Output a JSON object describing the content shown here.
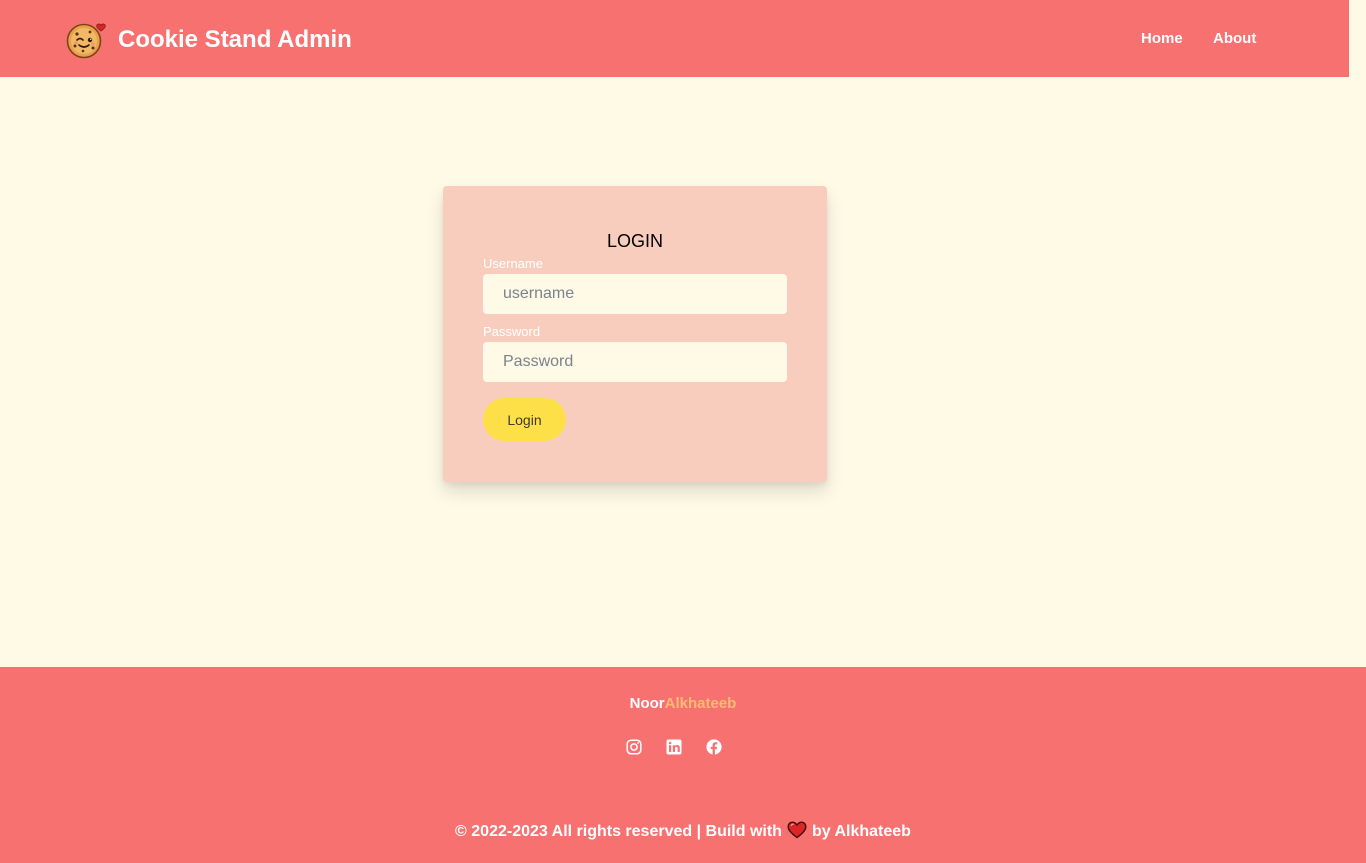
{
  "header": {
    "title": "Cookie Stand Admin",
    "logo_icon": "cookie-mascot-icon",
    "nav": {
      "home": "Home",
      "about": "About"
    }
  },
  "login": {
    "title": "LOGIN",
    "username": {
      "label": "Username",
      "placeholder": "username",
      "value": ""
    },
    "password": {
      "label": "Password",
      "placeholder": "Password",
      "value": ""
    },
    "button": "Login"
  },
  "footer": {
    "name_first": "Noor",
    "name_last": "Alkhateeb",
    "social_icons": [
      "instagram-icon",
      "linkedin-icon",
      "facebook-icon"
    ],
    "copyright_prefix": "© 2022-2023 All rights reserved | Build with",
    "copyright_suffix": "by Alkhateeb",
    "heart_icon": "heart-icon"
  },
  "colors": {
    "header_bg": "#F87171",
    "page_bg": "#FFFAE6",
    "card_bg": "#F9CDBD",
    "input_bg": "#FFFAE6",
    "button_bg": "#FDE047",
    "footer_bg": "#F87171",
    "accent_name": "#FDBA74",
    "heart": "#DC2626"
  }
}
